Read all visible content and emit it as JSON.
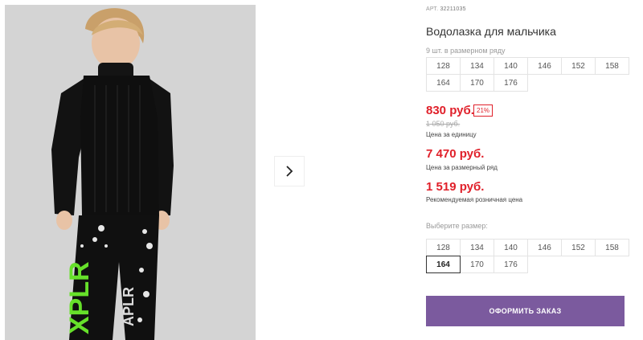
{
  "product": {
    "sku_label": "АРТ.",
    "sku_value": "32211035",
    "title": "Водолазка для мальчика",
    "photo_alt": "Мальчик в черной водолазке"
  },
  "gallery": {
    "next_icon": "chevron-right-icon"
  },
  "pack": {
    "note": "9 шт. в размерном ряду",
    "sizes": [
      "128",
      "134",
      "140",
      "146",
      "152",
      "158",
      "164",
      "170",
      "176"
    ]
  },
  "pricing": {
    "price": "830 руб.",
    "discount": "21%",
    "old_price": "1 050 руб.",
    "unit_label": "Цена за единицу",
    "pack_price": "7 470 руб.",
    "pack_label": "Цена за размерный ряд",
    "rrp_price": "1 519 руб.",
    "rrp_label": "Рекомендуемая розничная цена"
  },
  "size_select": {
    "label": "Выберите размер:",
    "sizes": [
      "128",
      "134",
      "140",
      "146",
      "152",
      "158",
      "164",
      "170",
      "176"
    ],
    "selected": "164"
  },
  "actions": {
    "order_label": "ОФОРМИТЬ ЗАКАЗ"
  },
  "colors": {
    "price_red": "#e0202a",
    "button_purple": "#7b5a9e",
    "photo_background": "#d4d4d4",
    "print_green": "#66e02a"
  }
}
